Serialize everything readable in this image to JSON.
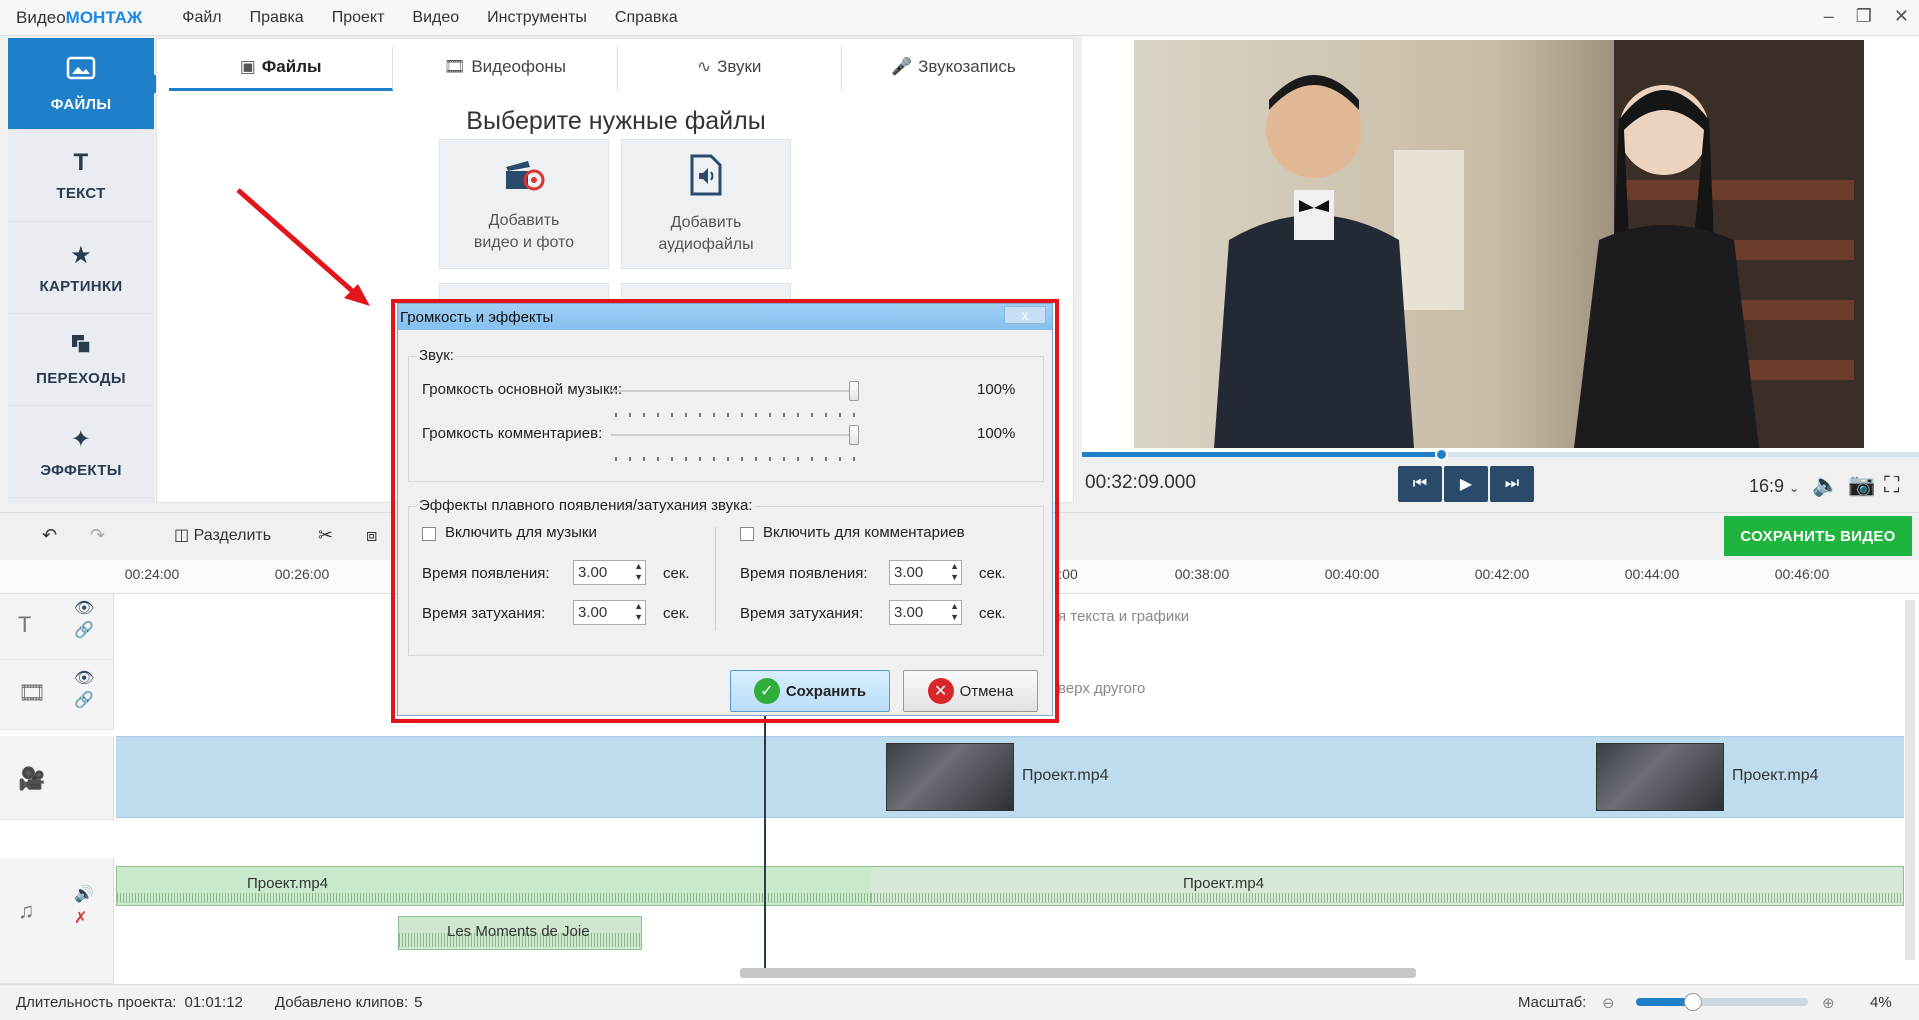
{
  "app": {
    "logo_prefix": "Видео",
    "logo_brand": "МОНТАЖ",
    "menu": [
      "Файл",
      "Правка",
      "Проект",
      "Видео",
      "Инструменты",
      "Справка"
    ]
  },
  "leftnav": [
    {
      "label": "ФАЙЛЫ",
      "icon": "image-icon",
      "active": true
    },
    {
      "label": "ТЕКСТ",
      "icon": "text-icon",
      "active": false
    },
    {
      "label": "КАРТИНКИ",
      "icon": "star-icon",
      "active": false
    },
    {
      "label": "ПЕРЕХОДЫ",
      "icon": "transitions-icon",
      "active": false
    },
    {
      "label": "ЭФФЕКТЫ",
      "icon": "magic-wand-icon",
      "active": false
    }
  ],
  "files_panel": {
    "tabs": [
      "Файлы",
      "Видеофоны",
      "Звуки",
      "Звукозапись"
    ],
    "title": "Выберите нужные файлы",
    "add_video_line1": "Добавить",
    "add_video_line2": "видео и фото",
    "add_audio_line1": "Добавить",
    "add_audio_line2": "аудиофайлы"
  },
  "preview": {
    "timecode": "00:32:09.000",
    "aspect": "16:9",
    "progress": 0.43
  },
  "toolbar": {
    "split_label": "Разделить",
    "save_video": "СОХРАНИТЬ ВИДЕО"
  },
  "ruler_labels": [
    "00:24:00",
    "00:26:00",
    ":00",
    "00:38:00",
    "00:40:00",
    "00:42:00",
    "00:44:00",
    "00:46:00"
  ],
  "timeline": {
    "hint_text": "я текста и графики",
    "hint_overlay": "верх другого",
    "video_clips": [
      "Проект.mp4",
      "Проект.mp4"
    ],
    "audio_clips": [
      "Проект.mp4",
      "Проект.mp4"
    ],
    "music_clip": "Les Moments de Joie"
  },
  "dialog": {
    "title": "Громкость и эффекты",
    "close": "x",
    "sound_group": "Звук:",
    "music_volume_label": "Громкость основной музыки:",
    "music_volume_value": "100%",
    "music_volume": 1.0,
    "comments_volume_label": "Громкость комментариев:",
    "comments_volume_value": "100%",
    "comments_volume": 1.0,
    "fade_group": "Эффекты плавного появления/затухания звука:",
    "music_checkbox": "Включить для музыки",
    "comments_checkbox": "Включить для комментариев",
    "fade_in_label": "Время появления:",
    "fade_out_label": "Время затухания:",
    "music_fade_in": "3.00",
    "music_fade_out": "3.00",
    "comments_fade_in": "3.00",
    "comments_fade_out": "3.00",
    "unit": "сек.",
    "save": "Сохранить",
    "cancel": "Отмена"
  },
  "statusbar": {
    "duration_label": "Длительность проекта:",
    "duration_value": "01:01:12",
    "clips_label": "Добавлено клипов:",
    "clips_value": "5",
    "zoom_label": "Масштаб:",
    "zoom_value": "4%",
    "zoom_level": 0.33
  },
  "colors": {
    "accent": "#1f7fc9",
    "save_green": "#1fb43d",
    "highlight_red": "#e3151a"
  }
}
